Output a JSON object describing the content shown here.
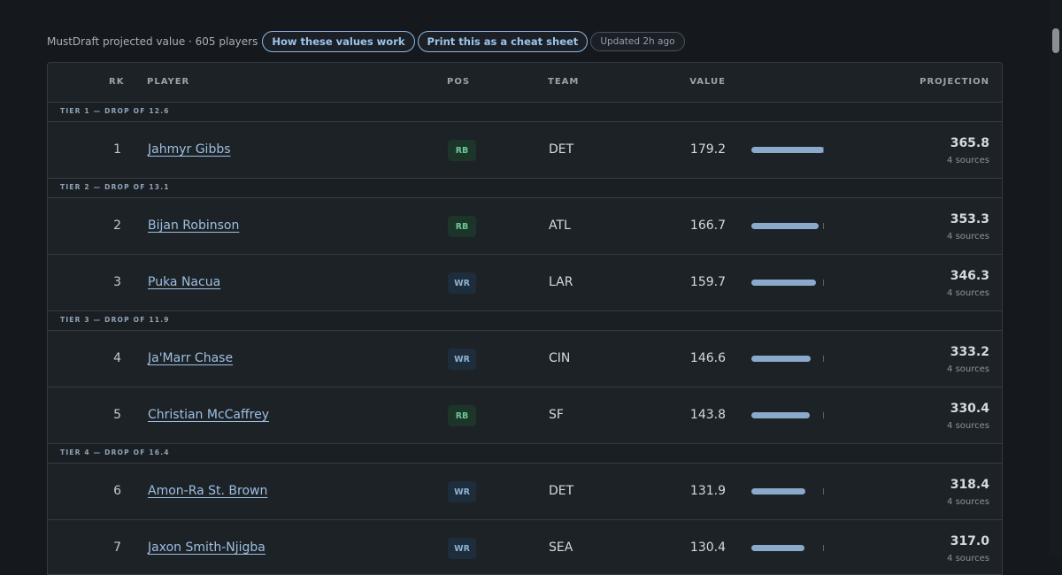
{
  "header": {
    "summary": "MustDraft projected value · 605 players",
    "how_label": "How these values work",
    "print_label": "Print this as a cheat sheet",
    "updated": "Updated 2h ago"
  },
  "table": {
    "columns": {
      "rk": "RK",
      "player": "PLAYER",
      "pos": "POS",
      "team": "TEAM",
      "value": "VALUE",
      "projection": "PROJECTION"
    },
    "tiers": [
      {
        "label": "TIER 1 — DROP OF 12.6",
        "players": [
          {
            "rk": "1",
            "name": "Jahmyr Gibbs",
            "pos": "RB",
            "team": "DET",
            "value": "179.2",
            "bar": 1.0,
            "projection": "365.8",
            "sources": "4 sources"
          }
        ]
      },
      {
        "label": "TIER 2 — DROP OF 13.1",
        "players": [
          {
            "rk": "2",
            "name": "Bijan Robinson",
            "pos": "RB",
            "team": "ATL",
            "value": "166.7",
            "bar": 0.93,
            "projection": "353.3",
            "sources": "4 sources"
          },
          {
            "rk": "3",
            "name": "Puka Nacua",
            "pos": "WR",
            "team": "LAR",
            "value": "159.7",
            "bar": 0.89,
            "projection": "346.3",
            "sources": "4 sources"
          }
        ]
      },
      {
        "label": "TIER 3 — DROP OF 11.9",
        "players": [
          {
            "rk": "4",
            "name": "Ja'Marr Chase",
            "pos": "WR",
            "team": "CIN",
            "value": "146.6",
            "bar": 0.82,
            "projection": "333.2",
            "sources": "4 sources"
          },
          {
            "rk": "5",
            "name": "Christian McCaffrey",
            "pos": "RB",
            "team": "SF",
            "value": "143.8",
            "bar": 0.8,
            "projection": "330.4",
            "sources": "4 sources"
          }
        ]
      },
      {
        "label": "TIER 4 — DROP OF 16.4",
        "players": [
          {
            "rk": "6",
            "name": "Amon-Ra St. Brown",
            "pos": "WR",
            "team": "DET",
            "value": "131.9",
            "bar": 0.74,
            "projection": "318.4",
            "sources": "4 sources"
          },
          {
            "rk": "7",
            "name": "Jaxon Smith-Njigba",
            "pos": "WR",
            "team": "SEA",
            "value": "130.4",
            "bar": 0.73,
            "projection": "317.0",
            "sources": "4 sources"
          }
        ]
      }
    ]
  },
  "colors": {
    "background": "#15191d",
    "table_bg": "#1d2226",
    "accent": "#9dbfe3",
    "rb": "#69c896",
    "wr": "#8fb1d4",
    "bar": "#8aaacb"
  }
}
